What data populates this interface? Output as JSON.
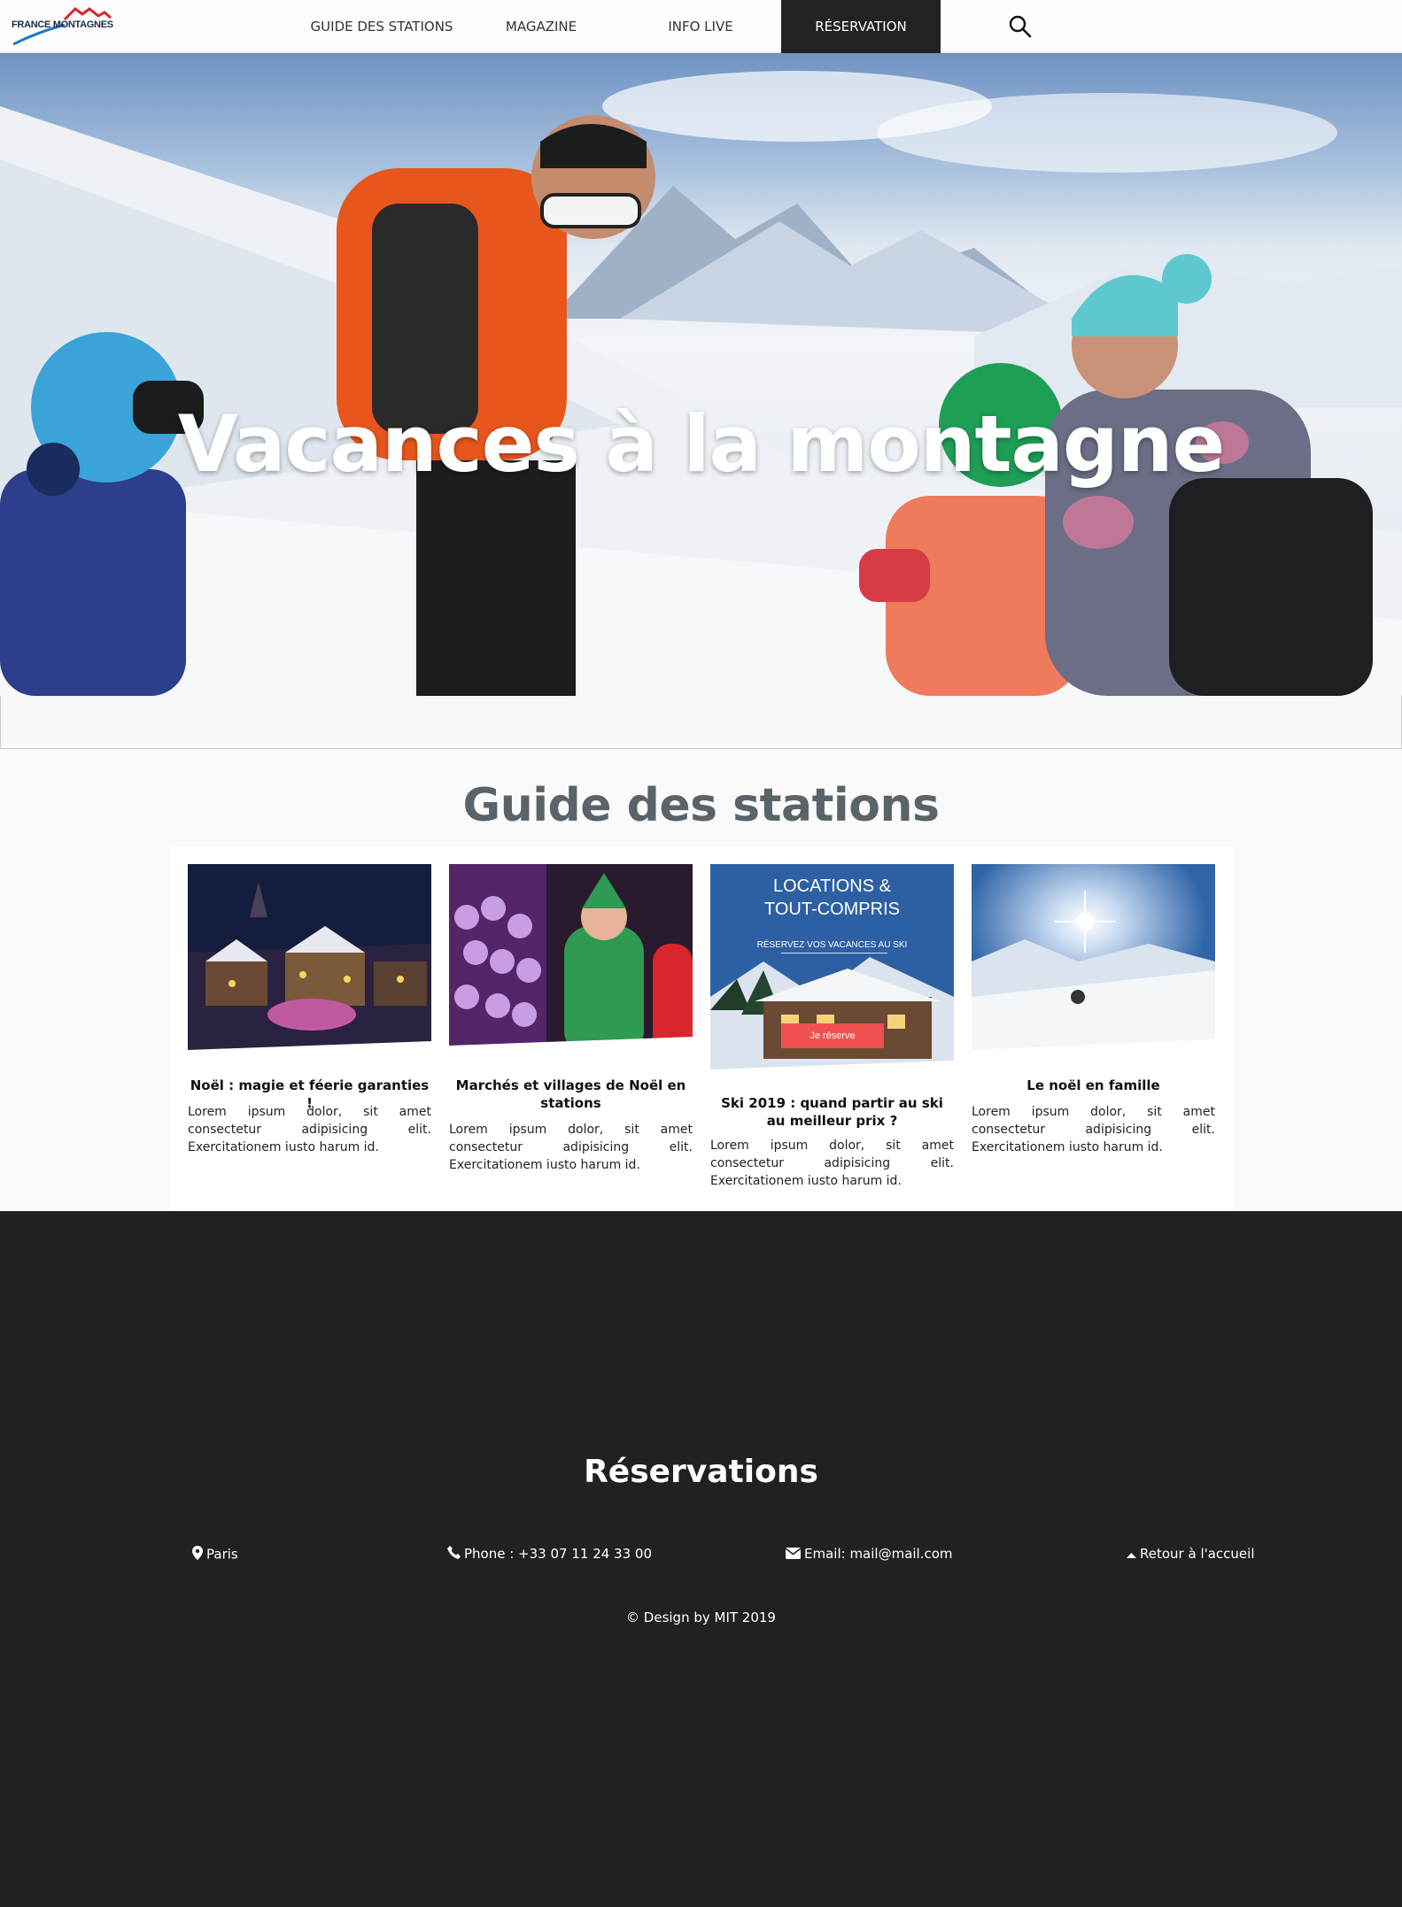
{
  "nav": {
    "logo_text": "FRANCE MONTAGNES",
    "items": [
      "GUIDE DES STATIONS",
      "MAGAZINE",
      "INFO LIVE",
      "RÉSERVATION"
    ],
    "active_index": 3,
    "search_icon": "search-icon"
  },
  "hero": {
    "title": "Vacances à la montagne"
  },
  "guide": {
    "title": "Guide des stations",
    "cards": [
      {
        "title": "Noël : magie et féerie garanties !",
        "text": "Lorem ipsum dolor, sit amet consectetur adipisicing elit. Exercitationem iusto harum id."
      },
      {
        "title": "Marchés et villages de Noël en stations",
        "text": "Lorem ipsum dolor, sit amet consectetur adipisicing elit. Exercitationem iusto harum id."
      },
      {
        "title": "Ski 2019 : quand partir au ski au meilleur prix ?",
        "text": "Lorem ipsum dolor, sit amet consectetur adipisicing elit. Exercitationem iusto harum id.",
        "ad": {
          "line1": "LOCATIONS &",
          "line2": "TOUT-COMPRIS",
          "sub": "RÉSERVEZ VOS VACANCES AU SKI",
          "button": "Je réserve"
        }
      },
      {
        "title": "Le noël en famille",
        "text": "Lorem ipsum dolor, sit amet consectetur adipisicing elit. Exercitationem iusto harum id."
      }
    ]
  },
  "footer": {
    "title": "Réservations",
    "location": "Paris",
    "phone": "Phone : +33 07 11 24 33 00",
    "email": "Email: mail@mail.com",
    "back": "Retour à l'accueil",
    "copyright": "© Design by MIT 2019"
  },
  "colors": {
    "nav_active_bg": "#222222",
    "footer_bg": "#212121",
    "guide_title": "#5a6468",
    "ad_button": "#f0504f",
    "ad_bg": "#2d5fa3"
  }
}
